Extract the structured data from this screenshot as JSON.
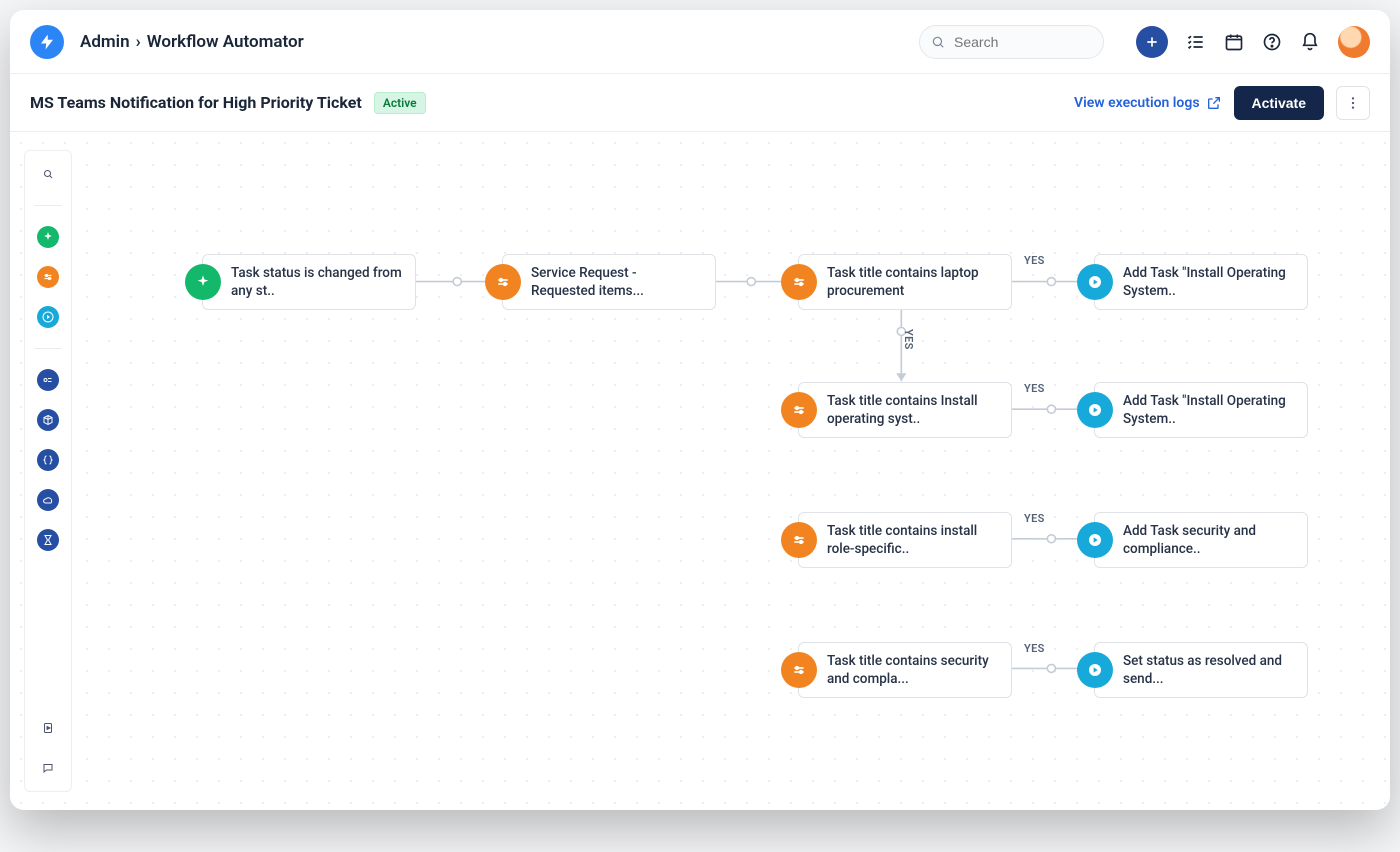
{
  "breadcrumb": {
    "root": "Admin",
    "page": "Workflow Automator"
  },
  "search": {
    "placeholder": "Search"
  },
  "topbar_icons": {
    "add": "plus-icon",
    "list": "checklist-icon",
    "calendar": "calendar-icon",
    "help": "help-icon",
    "bell": "bell-icon",
    "avatar": "avatar"
  },
  "subheader": {
    "title": "MS Teams Notification for High Priority Ticket",
    "status": "Active",
    "view_logs": "View execution logs",
    "activate": "Activate"
  },
  "labels": {
    "yes": "YES"
  },
  "nodes": {
    "trigger": "Task status is changed from any st..",
    "cond1": "Service Request - Requested items...",
    "cond2": "Task title contains laptop procurement",
    "action2": "Add Task \"Install Operating System..",
    "cond3": "Task title contains Install operating syst..",
    "action3": "Add Task \"Install Operating System..",
    "cond4": "Task title contains install role-specific..",
    "action4": "Add Task security and compliance..",
    "cond5": "Task title contains security and compla...",
    "action5": "Set status as resolved and send..."
  },
  "toolrail": {
    "search": "search-icon",
    "event": "event-icon",
    "condition": "condition-icon",
    "action": "action-icon",
    "form": "form-icon",
    "object": "object-icon",
    "code": "code-icon",
    "cloud": "cloud-icon",
    "timer": "timer-icon",
    "docs": "docs-icon",
    "chat": "chat-icon"
  }
}
